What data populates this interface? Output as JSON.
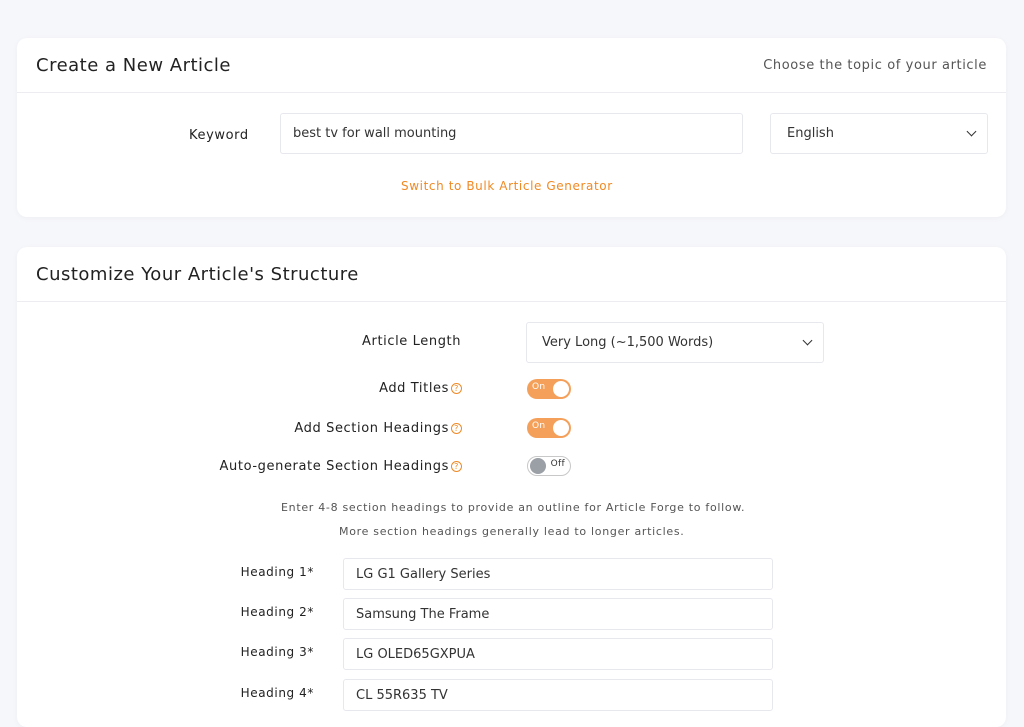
{
  "create_card": {
    "title": "Create a New Article",
    "subtitle": "Choose the topic of your article",
    "keyword_label": "Keyword",
    "keyword_value": "best tv for wall mounting",
    "language_value": "English",
    "bulk_link": "Switch to Bulk Article Generator"
  },
  "structure_card": {
    "title": "Customize Your Article's Structure",
    "length_label": "Article Length",
    "length_value": "Very Long (~1,500 Words)",
    "toggles": [
      {
        "label": "Add Titles",
        "state": "On"
      },
      {
        "label": "Add Section Headings",
        "state": "On"
      },
      {
        "label": "Auto-generate Section Headings",
        "state": "Off"
      }
    ],
    "note_line1": "Enter 4-8 section headings to provide an outline for Article Forge to follow.",
    "note_line2": "More section headings generally lead to longer articles.",
    "headings": [
      {
        "label": "Heading 1*",
        "value": "LG G1 Gallery Series"
      },
      {
        "label": "Heading 2*",
        "value": "Samsung The Frame"
      },
      {
        "label": "Heading 3*",
        "value": "LG OLED65GXPUA"
      },
      {
        "label": "Heading 4*",
        "value": "CL 55R635 TV"
      }
    ]
  },
  "colors": {
    "accent": "#f08a24",
    "toggle_on": "#f5a05a",
    "background": "#f6f7fb"
  }
}
